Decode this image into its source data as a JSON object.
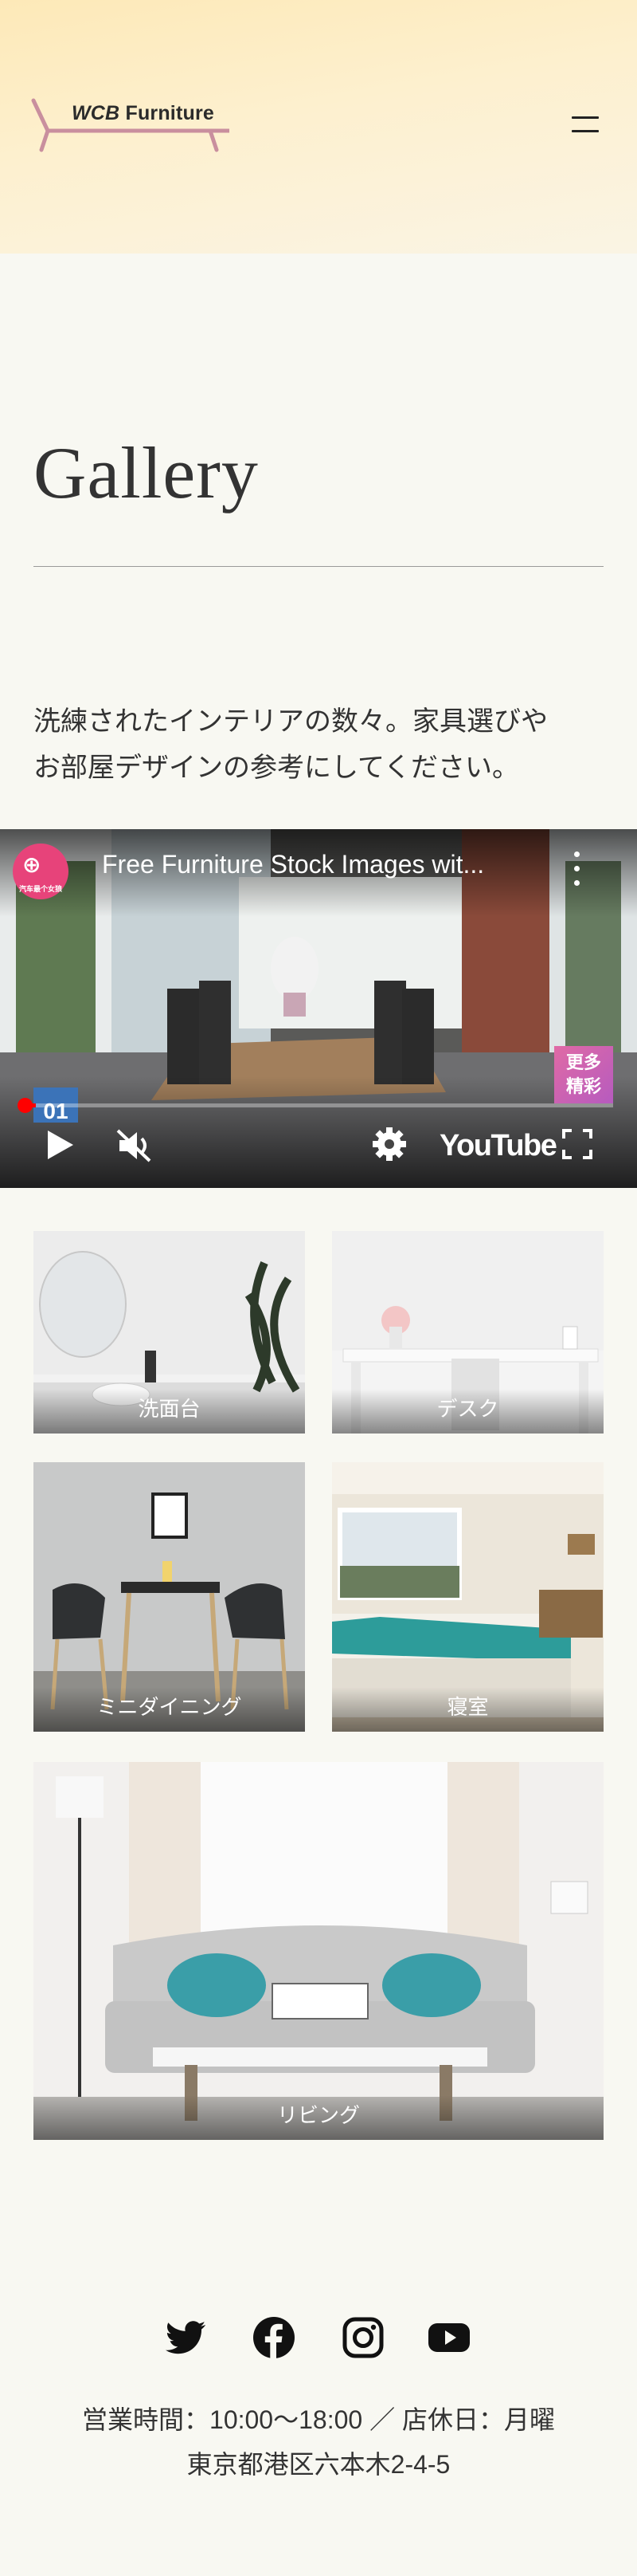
{
  "header": {
    "logo_prefix": "WCB",
    "logo_suffix": "Furniture",
    "menu_icon": "hamburger-icon"
  },
  "main": {
    "title": "Gallery",
    "intro_line1": "洗練されたインテリアの数々。家具選びや",
    "intro_line2": "お部屋デザインの参考にしてください。"
  },
  "video": {
    "channel_name": "汽车最个女狼",
    "title": "Free Furniture Stock Images wit...",
    "badge": "更多精彩",
    "badge_line1": "更多",
    "badge_line2": "精彩",
    "segment_label": "01",
    "brand": "YouTube",
    "progress": 0.02,
    "icons": [
      "play-icon",
      "mute-icon",
      "settings-icon",
      "fullscreen-icon",
      "more-vert-icon"
    ]
  },
  "gallery": {
    "items": [
      {
        "caption": "洗面台"
      },
      {
        "caption": "デスク"
      },
      {
        "caption": "ミニダイニング"
      },
      {
        "caption": "寝室"
      },
      {
        "caption": "リビング"
      }
    ]
  },
  "footer": {
    "social_icons": [
      "twitter-icon",
      "facebook-icon",
      "instagram-icon",
      "youtube-icon"
    ],
    "hours": "営業時間：10:00〜18:00 ／ 店休日：月曜",
    "address": "東京都港区六本木2-4-5"
  }
}
